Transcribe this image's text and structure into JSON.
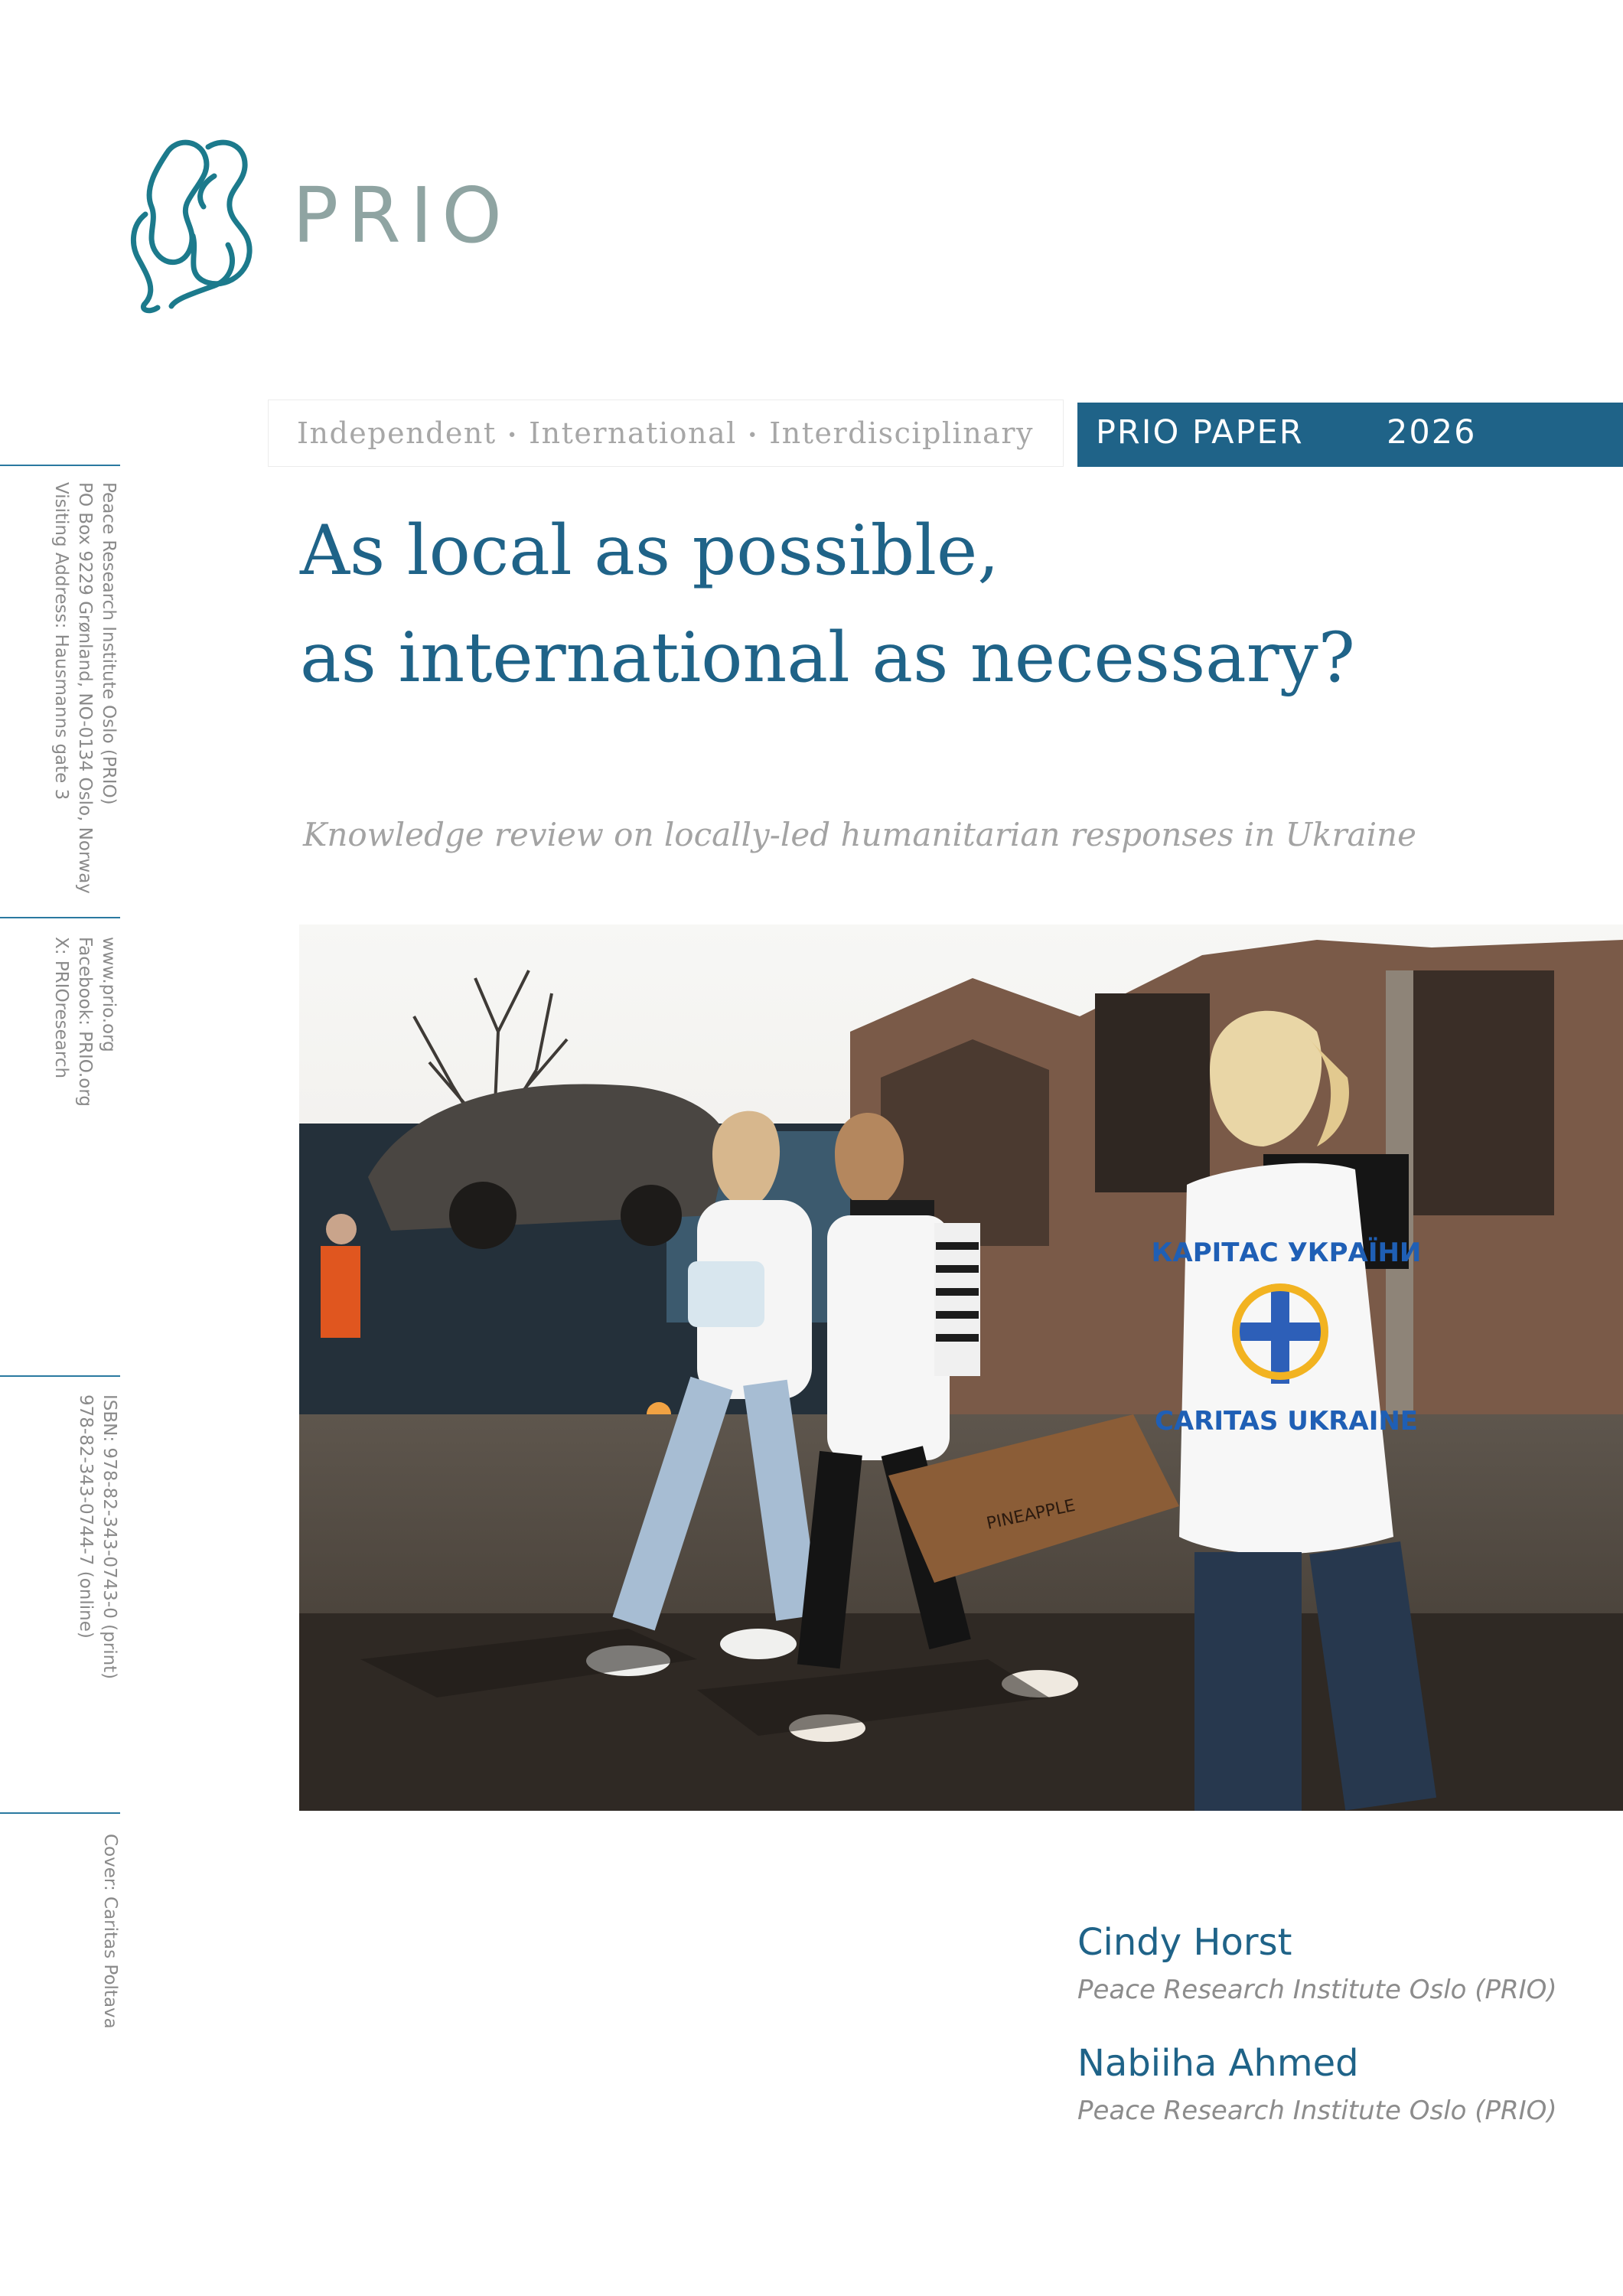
{
  "logo": {
    "wordmark": "PRIO",
    "icon": "prio-emblem-icon",
    "color": "#1c7a8c"
  },
  "header": {
    "tagline_parts": [
      "Independent",
      "International",
      "Interdisciplinary"
    ],
    "tagline_separator": "•",
    "series_label": "PRIO PAPER",
    "series_year": "2026",
    "accent_color": "#1f6388"
  },
  "sidebar": {
    "address_lines": [
      "Peace Research Institute Oslo (PRIO)",
      "PO Box 9229 Grønland, NO-0134 Oslo, Norway",
      "Visiting Address: Hausmanns gate 3"
    ],
    "web_lines": [
      "www.prio.org",
      "Facebook: PRIO.org",
      "X: PRIOresearch"
    ],
    "isbn_lines": [
      "ISBN: 978-82-343-0743-0 (print)",
      "978-82-343-0744-7 (online)"
    ],
    "cover_credit": "Cover: Caritas Poltava"
  },
  "main": {
    "title_line1": "As local as possible,",
    "title_line2": "as international as necessary?",
    "subtitle": "Knowledge review on locally-led humanitarian responses in Ukraine"
  },
  "cover_photo": {
    "vest_top_text": "КАРІТАС УКРАЇНИ",
    "vest_bottom_text": "CARITAS UKRAINE",
    "box_label": "PINEAPPLE"
  },
  "authors": [
    {
      "name": "Cindy Horst",
      "affiliation": "Peace Research Institute Oslo (PRIO)"
    },
    {
      "name": "Nabiiha Ahmed",
      "affiliation": "Peace Research Institute Oslo (PRIO)"
    }
  ]
}
